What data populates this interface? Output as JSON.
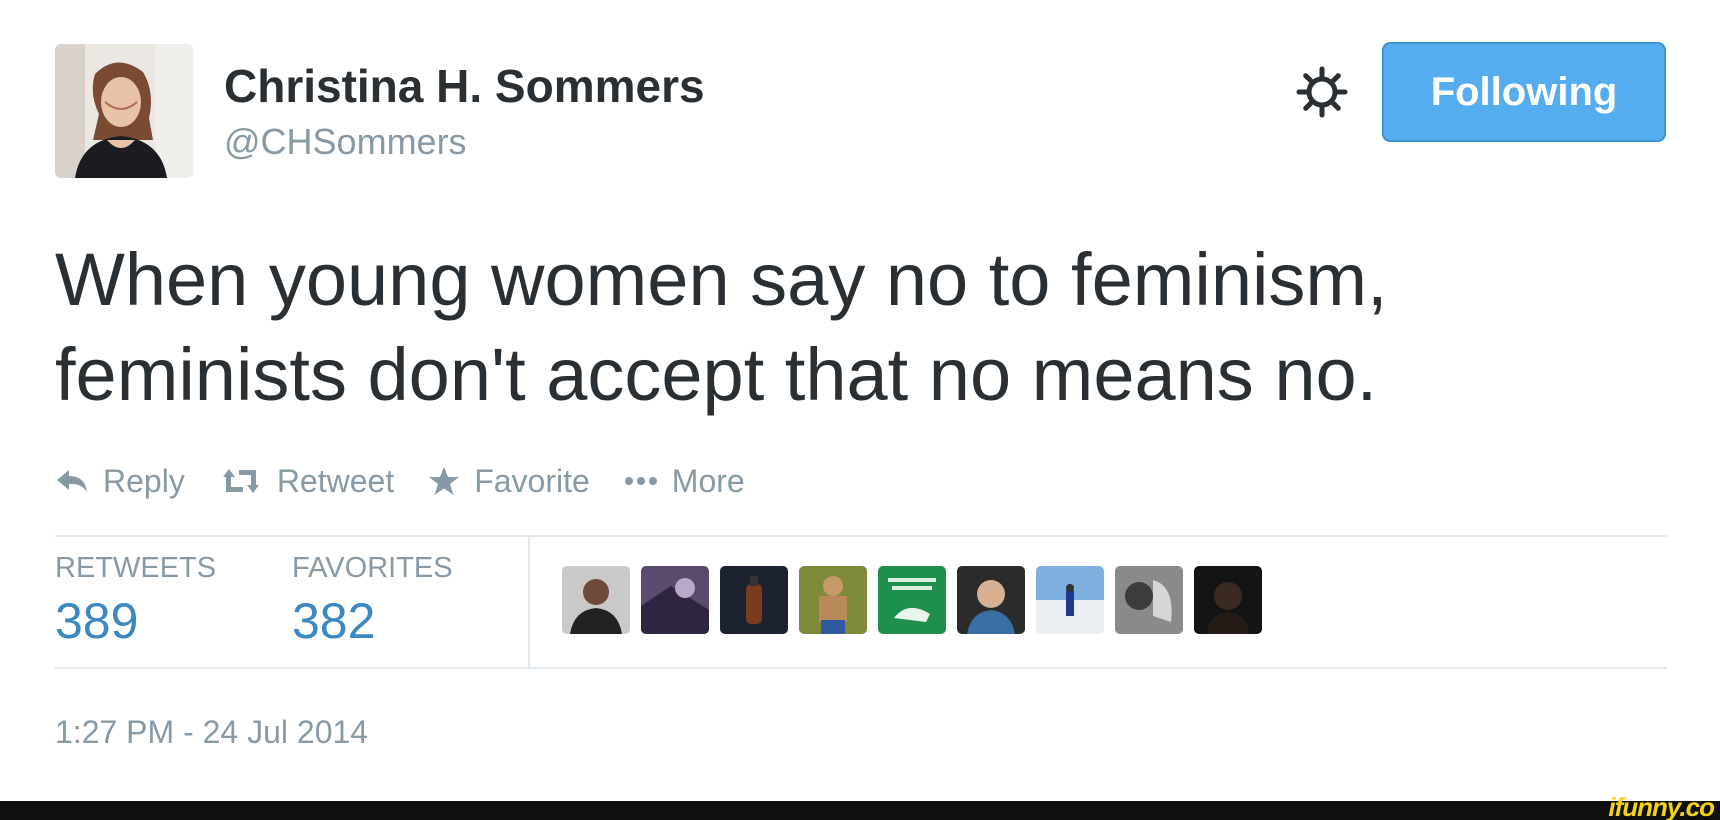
{
  "author": {
    "name": "Christina H. Sommers",
    "handle": "@CHSommers"
  },
  "follow_button": {
    "label": "Following",
    "color": "#55acee"
  },
  "tweet": {
    "line1": "When young women say no to feminism,",
    "line2": "feminists don't accept that no means no."
  },
  "actions": [
    {
      "label": "Reply",
      "icon": "reply-icon"
    },
    {
      "label": "Retweet",
      "icon": "retweet-icon"
    },
    {
      "label": "Favorite",
      "icon": "star-icon"
    },
    {
      "label": "More",
      "icon": "more-dots-icon"
    }
  ],
  "stats": {
    "retweets_label": "RETWEETS",
    "retweets_value": "389",
    "favorites_label": "FAVORITES",
    "favorites_value": "382"
  },
  "favoriter_avatar_count": 9,
  "timestamp": "1:27 PM - 24 Jul 2014",
  "watermark": "ifunny.co",
  "colors": {
    "text": "#292f33",
    "muted": "#8899a6",
    "stat_value": "#3b88c3",
    "divider": "#e1e8ed"
  }
}
